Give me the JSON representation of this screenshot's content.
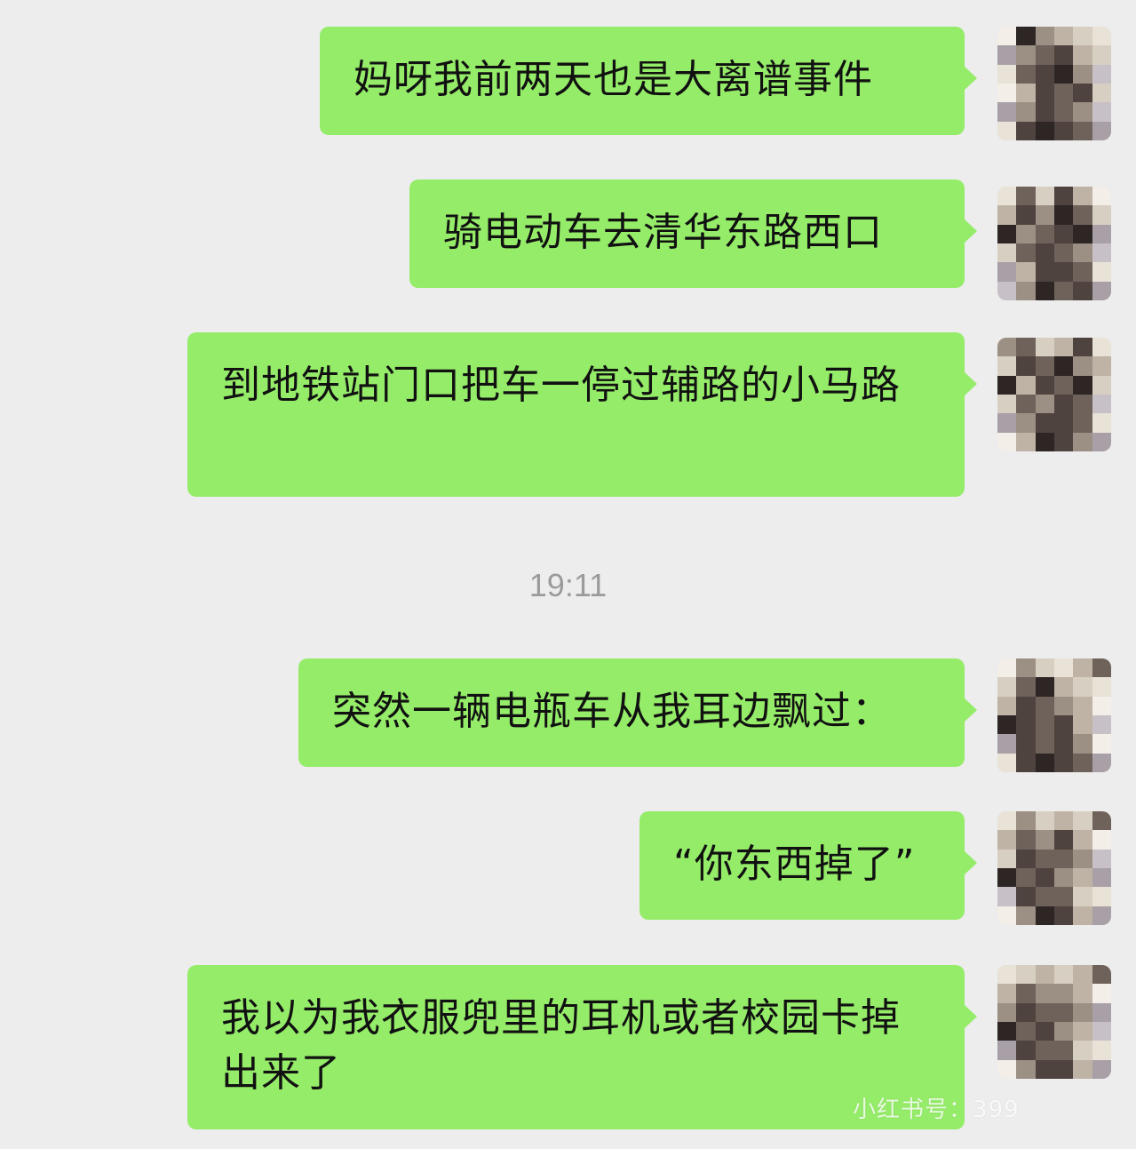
{
  "conversation": {
    "messages": [
      {
        "text": "妈呀我前两天也是大离谱事件",
        "sender": "self"
      },
      {
        "text": "骑电动车去清华东路西口",
        "sender": "self"
      },
      {
        "text": "到地铁站门口把车一停过辅路的小马路",
        "sender": "self"
      },
      {
        "text": "突然一辆电瓶车从我耳边飘过：",
        "sender": "self"
      },
      {
        "text": "“你东西掉了”",
        "sender": "self"
      },
      {
        "text": "我以为我衣服兜里的耳机或者校园卡掉出来了",
        "sender": "self"
      }
    ],
    "timestamp": "19:11"
  },
  "watermark": {
    "text": "小红书号：399"
  },
  "colors": {
    "background": "#ededed",
    "bubble_self": "#95ec69",
    "timestamp_text": "#9b9b9b"
  },
  "icons": {
    "avatar": "pixelated-avatar-icon"
  }
}
